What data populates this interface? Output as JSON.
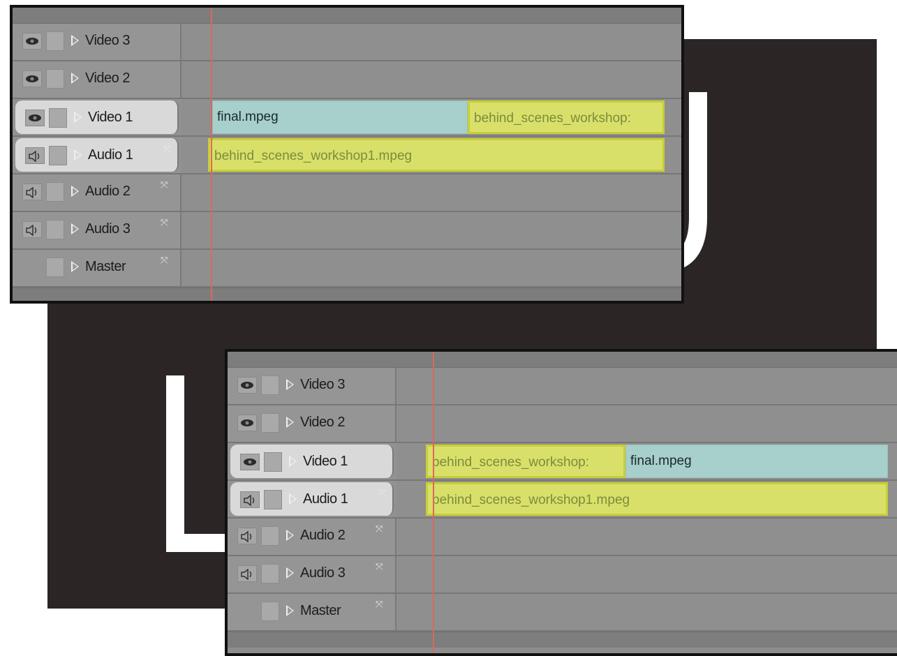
{
  "colors": {
    "backdrop": "#2b2526",
    "video_clip": "#a7cfcb",
    "audio_clip": "#d9e06a",
    "playhead": "#d86a5a"
  },
  "labels": {
    "top_letter": "J",
    "bottom_letter": "L"
  },
  "tracks": {
    "video3": "Video 3",
    "video2": "Video 2",
    "video1": "Video 1",
    "audio1": "Audio 1",
    "audio2": "Audio 2",
    "audio3": "Audio 3",
    "master": "Master"
  },
  "icons": {
    "video": "eye-icon",
    "audio": "speaker-icon",
    "lock": "lock-box",
    "expand": "triangle-right-icon",
    "sync": "sync-arrows-icon"
  },
  "top_timeline": {
    "video1_clip_a": "final.mpeg",
    "video1_clip_b": "behind_scenes_workshop:",
    "audio1_clip": "behind_scenes_workshop1.mpeg"
  },
  "bottom_timeline": {
    "video1_clip_a": "behind_scenes_workshop:",
    "video1_clip_b": "final.mpeg",
    "audio1_clip": "behind_scenes_workshop1.mpeg"
  }
}
